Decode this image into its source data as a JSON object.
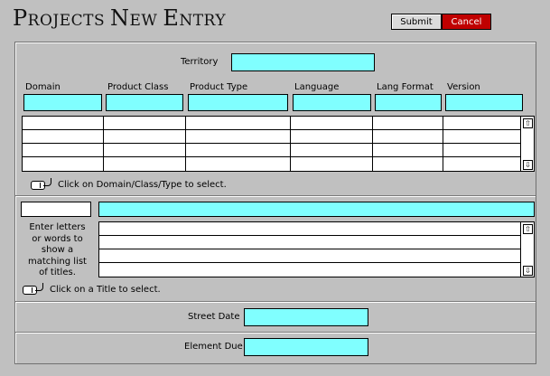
{
  "header": {
    "title_parts": [
      "P",
      "ROJECTS ",
      "N",
      "EW ",
      "E",
      "NTRY"
    ],
    "submit_label": "Submit",
    "cancel_label": "Cancel"
  },
  "territory": {
    "label": "Territory",
    "value": ""
  },
  "columns": [
    {
      "label": "Domain",
      "value": ""
    },
    {
      "label": "Product Class",
      "value": ""
    },
    {
      "label": "Product Type",
      "value": ""
    },
    {
      "label": "Language",
      "value": ""
    },
    {
      "label": "Lang Format",
      "value": ""
    },
    {
      "label": "Version",
      "value": ""
    }
  ],
  "selection_hint": "Click on Domain/Class/Type to select.",
  "title_search": {
    "instruction": "Enter letters or words to show a matching list of titles.",
    "instruction_lines": [
      "Enter letters",
      "or words to",
      "show a",
      "matching list",
      "of titles."
    ],
    "hint": "Click on a Title to select.",
    "code_value": "",
    "search_value": ""
  },
  "street_date": {
    "label": "Street Date",
    "value": ""
  },
  "element_due": {
    "label": "Element Due",
    "value": ""
  },
  "icons": {
    "scroll_up": "scroll-up-arrow-icon",
    "scroll_down": "scroll-down-arrow-icon",
    "pointer_hint": "mouse-click-icon"
  },
  "colors": {
    "field": "#80ffff",
    "cancel": "#c00000",
    "background": "#c0c0c0"
  }
}
